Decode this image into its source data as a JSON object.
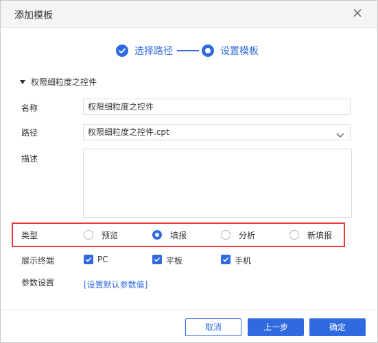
{
  "dialog": {
    "title": "添加模板"
  },
  "steps": [
    {
      "label": "选择路径",
      "state": "done"
    },
    {
      "label": "设置模板",
      "state": "current"
    }
  ],
  "section": {
    "label": "权限细粒度之控件"
  },
  "form": {
    "name_label": "名称",
    "name_value": "权限细粒度之控件",
    "path_label": "路径",
    "path_value": "权限细粒度之控件.cpt",
    "desc_label": "描述",
    "desc_value": "",
    "type_label": "类型",
    "type_options": [
      {
        "label": "预览",
        "selected": false
      },
      {
        "label": "填报",
        "selected": true
      },
      {
        "label": "分析",
        "selected": false
      },
      {
        "label": "新填报",
        "selected": false
      }
    ],
    "terminal_label": "展示终端",
    "terminals": [
      {
        "label": "PC",
        "checked": true
      },
      {
        "label": "平板",
        "checked": true
      },
      {
        "label": "手机",
        "checked": true
      }
    ],
    "params_label": "参数设置",
    "params_link": "[设置默认参数值]"
  },
  "buttons": {
    "cancel": "取消",
    "prev": "上一步",
    "ok": "确定"
  },
  "colors": {
    "accent": "#2f6ae1",
    "highlight": "#e53935"
  }
}
